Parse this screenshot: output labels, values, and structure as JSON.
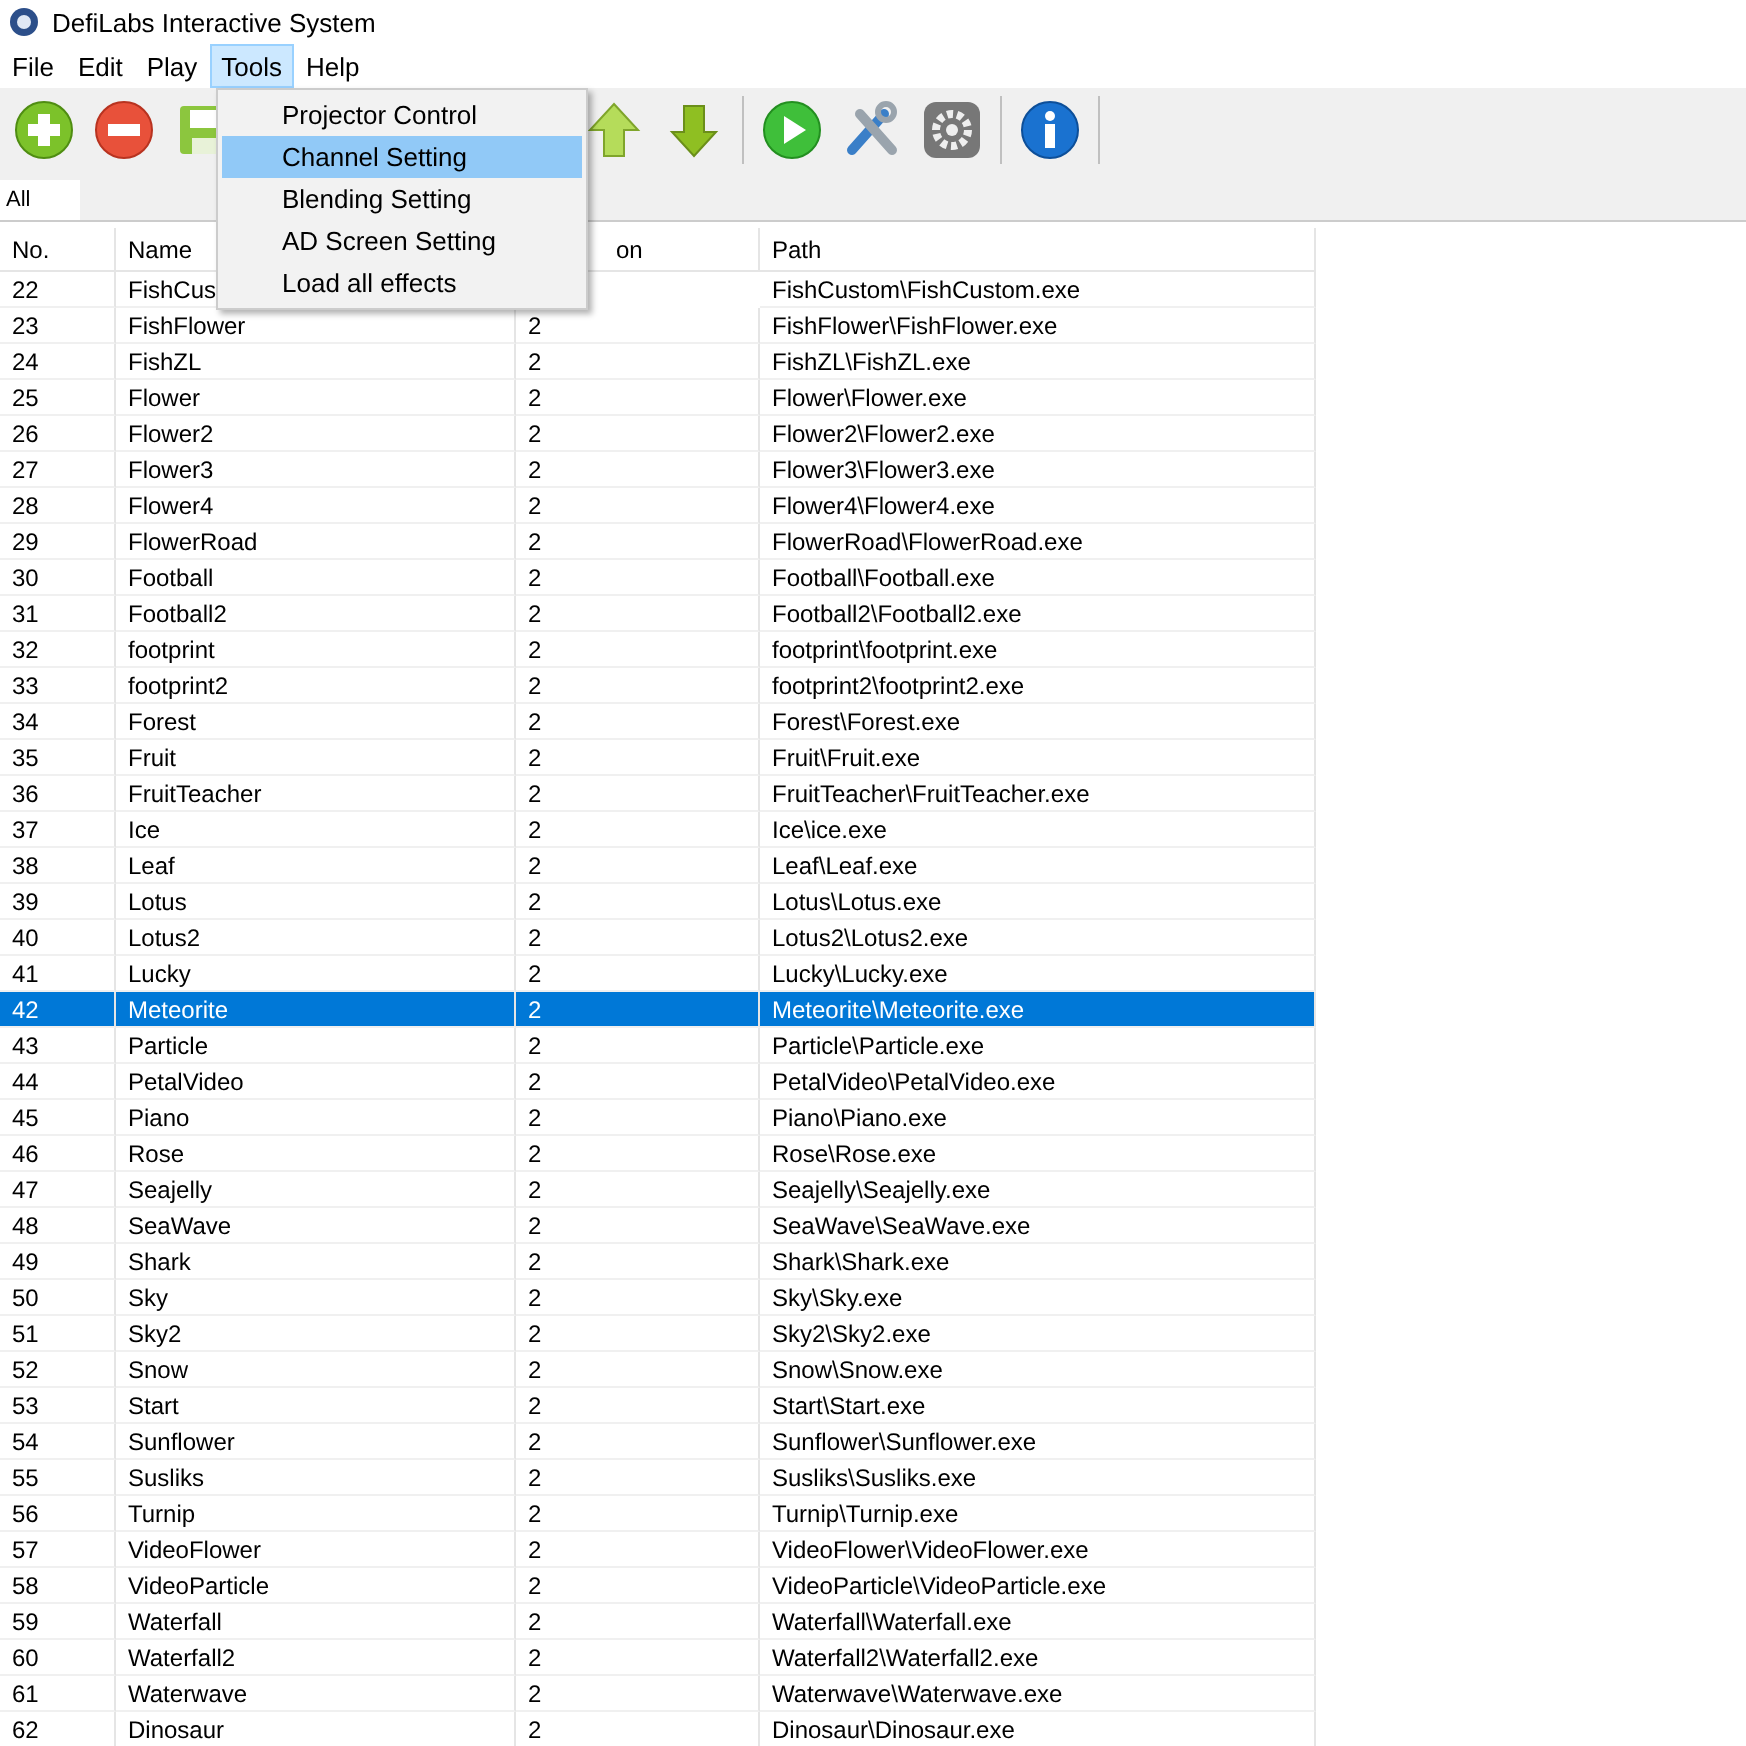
{
  "window": {
    "title": "DefiLabs Interactive System"
  },
  "menu_bar": [
    {
      "label": "File",
      "selected": false
    },
    {
      "label": "Edit",
      "selected": false
    },
    {
      "label": "Play",
      "selected": false
    },
    {
      "label": "Tools",
      "selected": true
    },
    {
      "label": "Help",
      "selected": false
    }
  ],
  "tools_menu": [
    {
      "label": "Projector Control",
      "selected": false
    },
    {
      "label": "Channel Setting",
      "selected": true
    },
    {
      "label": "Blending Setting",
      "selected": false
    },
    {
      "label": "AD Screen Setting",
      "selected": false
    },
    {
      "label": "Load all effects",
      "selected": false
    }
  ],
  "toolbar": [
    {
      "kind": "add"
    },
    {
      "kind": "remove"
    },
    {
      "kind": "save"
    },
    {
      "kind": "up"
    },
    {
      "kind": "down"
    },
    {
      "kind": "sep"
    },
    {
      "kind": "play"
    },
    {
      "kind": "tools"
    },
    {
      "kind": "gear"
    },
    {
      "kind": "sep"
    },
    {
      "kind": "info"
    },
    {
      "kind": "sep"
    }
  ],
  "tabs": [
    {
      "label": "All",
      "selected": true
    }
  ],
  "table": {
    "columns": [
      "No.",
      "Name",
      "on",
      "Path"
    ],
    "rows": [
      {
        "no": "22",
        "name": "FishCus",
        "path": "FishCustom\\FishCustom.exe",
        "selected": false
      },
      {
        "no": "23",
        "name": "FishFlower",
        "column_3": "2",
        "path": "FishFlower\\FishFlower.exe",
        "selected": false
      },
      {
        "no": "24",
        "name": "FishZL",
        "column_3": "2",
        "path": "FishZL\\FishZL.exe",
        "selected": false
      },
      {
        "no": "25",
        "name": "Flower",
        "column_3": "2",
        "path": "Flower\\Flower.exe",
        "selected": false
      },
      {
        "no": "26",
        "name": "Flower2",
        "column_3": "2",
        "path": "Flower2\\Flower2.exe",
        "selected": false
      },
      {
        "no": "27",
        "name": "Flower3",
        "column_3": "2",
        "path": "Flower3\\Flower3.exe",
        "selected": false
      },
      {
        "no": "28",
        "name": "Flower4",
        "column_3": "2",
        "path": "Flower4\\Flower4.exe",
        "selected": false
      },
      {
        "no": "29",
        "name": "FlowerRoad",
        "column_3": "2",
        "path": "FlowerRoad\\FlowerRoad.exe",
        "selected": false
      },
      {
        "no": "30",
        "name": "Football",
        "column_3": "2",
        "path": "Football\\Football.exe",
        "selected": false
      },
      {
        "no": "31",
        "name": "Football2",
        "column_3": "2",
        "path": "Football2\\Football2.exe",
        "selected": false
      },
      {
        "no": "32",
        "name": "footprint",
        "column_3": "2",
        "path": "footprint\\footprint.exe",
        "selected": false
      },
      {
        "no": "33",
        "name": "footprint2",
        "column_3": "2",
        "path": "footprint2\\footprint2.exe",
        "selected": false
      },
      {
        "no": "34",
        "name": "Forest",
        "column_3": "2",
        "path": "Forest\\Forest.exe",
        "selected": false
      },
      {
        "no": "35",
        "name": "Fruit",
        "column_3": "2",
        "path": "Fruit\\Fruit.exe",
        "selected": false
      },
      {
        "no": "36",
        "name": "FruitTeacher",
        "column_3": "2",
        "path": "FruitTeacher\\FruitTeacher.exe",
        "selected": false
      },
      {
        "no": "37",
        "name": "Ice",
        "column_3": "2",
        "path": "Ice\\ice.exe",
        "selected": false
      },
      {
        "no": "38",
        "name": "Leaf",
        "column_3": "2",
        "path": "Leaf\\Leaf.exe",
        "selected": false
      },
      {
        "no": "39",
        "name": "Lotus",
        "column_3": "2",
        "path": "Lotus\\Lotus.exe",
        "selected": false
      },
      {
        "no": "40",
        "name": "Lotus2",
        "column_3": "2",
        "path": "Lotus2\\Lotus2.exe",
        "selected": false
      },
      {
        "no": "41",
        "name": "Lucky",
        "column_3": "2",
        "path": "Lucky\\Lucky.exe",
        "selected": false
      },
      {
        "no": "42",
        "name": "Meteorite",
        "column_3": "2",
        "path": "Meteorite\\Meteorite.exe",
        "selected": true
      },
      {
        "no": "43",
        "name": "Particle",
        "column_3": "2",
        "path": "Particle\\Particle.exe",
        "selected": false
      },
      {
        "no": "44",
        "name": "PetalVideo",
        "column_3": "2",
        "path": "PetalVideo\\PetalVideo.exe",
        "selected": false
      },
      {
        "no": "45",
        "name": "Piano",
        "column_3": "2",
        "path": "Piano\\Piano.exe",
        "selected": false
      },
      {
        "no": "46",
        "name": "Rose",
        "column_3": "2",
        "path": "Rose\\Rose.exe",
        "selected": false
      },
      {
        "no": "47",
        "name": "Seajelly",
        "column_3": "2",
        "path": "Seajelly\\Seajelly.exe",
        "selected": false
      },
      {
        "no": "48",
        "name": "SeaWave",
        "column_3": "2",
        "path": "SeaWave\\SeaWave.exe",
        "selected": false
      },
      {
        "no": "49",
        "name": "Shark",
        "column_3": "2",
        "path": "Shark\\Shark.exe",
        "selected": false
      },
      {
        "no": "50",
        "name": "Sky",
        "column_3": "2",
        "path": "Sky\\Sky.exe",
        "selected": false
      },
      {
        "no": "51",
        "name": "Sky2",
        "column_3": "2",
        "path": "Sky2\\Sky2.exe",
        "selected": false
      },
      {
        "no": "52",
        "name": "Snow",
        "column_3": "2",
        "path": "Snow\\Snow.exe",
        "selected": false
      },
      {
        "no": "53",
        "name": "Start",
        "column_3": "2",
        "path": "Start\\Start.exe",
        "selected": false
      },
      {
        "no": "54",
        "name": "Sunflower",
        "column_3": "2",
        "path": "Sunflower\\Sunflower.exe",
        "selected": false
      },
      {
        "no": "55",
        "name": "Susliks",
        "column_3": "2",
        "path": "Susliks\\Susliks.exe",
        "selected": false
      },
      {
        "no": "56",
        "name": "Turnip",
        "column_3": "2",
        "path": "Turnip\\Turnip.exe",
        "selected": false
      },
      {
        "no": "57",
        "name": "VideoFlower",
        "column_3": "2",
        "path": "VideoFlower\\VideoFlower.exe",
        "selected": false
      },
      {
        "no": "58",
        "name": "VideoParticle",
        "column_3": "2",
        "path": "VideoParticle\\VideoParticle.exe",
        "selected": false
      },
      {
        "no": "59",
        "name": "Waterfall",
        "column_3": "2",
        "path": "Waterfall\\Waterfall.exe",
        "selected": false
      },
      {
        "no": "60",
        "name": "Waterfall2",
        "column_3": "2",
        "path": "Waterfall2\\Waterfall2.exe",
        "selected": false
      },
      {
        "no": "61",
        "name": "Waterwave",
        "column_3": "2",
        "path": "Waterwave\\Waterwave.exe",
        "selected": false
      },
      {
        "no": "62",
        "name": "Dinosaur",
        "column_3": "2",
        "path": "Dinosaur\\Dinosaur.exe",
        "selected": false
      }
    ]
  }
}
